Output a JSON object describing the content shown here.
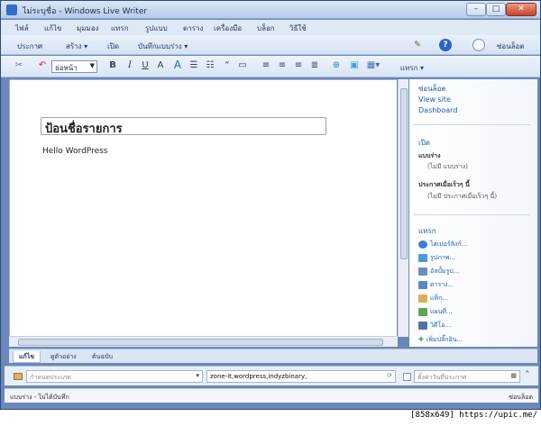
{
  "window": {
    "title": "ไม่ระบุชื่อ - Windows Live Writer"
  },
  "menubar": {
    "items": [
      "ไฟล์",
      "แก้ไข",
      "มุมมอง",
      "แทรก",
      "รูปแบบ",
      "ตาราง",
      "เครื่องมือ",
      "บล็อก",
      "วิธีใช้"
    ]
  },
  "commandbar": {
    "publish": "ประกาศ",
    "new": "สร้าง",
    "open": "เปิด",
    "save_draft": "บันทึกแบบร่าง",
    "blog_name": "ซ่อนล็อต"
  },
  "formatbar": {
    "style_value": "ย่อหน้า",
    "bold": "B",
    "italic": "I",
    "underline": "U",
    "insert_label": "แทรก"
  },
  "editor": {
    "post_title": "ป้อนชื่อรายการ",
    "body": "Hello WordPress"
  },
  "sidebar": {
    "blog_heading": "ซ่อนล็อต",
    "blog_links": [
      "View site",
      "Dashboard"
    ],
    "open_heading": "เปิด",
    "drafts_label": "แบบร่าง",
    "drafts_empty": "(ไม่มี แบบร่าง)",
    "recent_label": "ประกาศเมื่อเร็วๆ นี้",
    "recent_empty": "(ไม่มี ประกาศเมื่อเร็วๆ นี้)",
    "insert_heading": "แทรก",
    "insert_items": [
      {
        "label": "ไฮเปอร์ลิงก์...",
        "icon": "hyperlink-icon",
        "color": "#3b7ed0"
      },
      {
        "label": "รูปภาพ...",
        "icon": "picture-icon",
        "color": "#4a9ad8"
      },
      {
        "label": "อัลบั้มรูป...",
        "icon": "photo-album-icon",
        "color": "#6a8fbf"
      },
      {
        "label": "ตาราง...",
        "icon": "table-icon",
        "color": "#5b88c5"
      },
      {
        "label": "แท็ก...",
        "icon": "tag-icon",
        "color": "#d8b15a"
      },
      {
        "label": "แผนที่...",
        "icon": "map-icon",
        "color": "#5aa55a"
      },
      {
        "label": "วิดีโอ...",
        "icon": "video-icon",
        "color": "#4f72a8"
      },
      {
        "label": "เพิ่มปลั๊กอิน...",
        "icon": "add-plugin-icon",
        "color": "#3aa33a"
      }
    ]
  },
  "tabs": [
    "แก้ไข",
    "ดูตัวอย่าง",
    "ต้นฉบับ"
  ],
  "properties": {
    "category_placeholder": "กำหนดประเภท",
    "tags_value": "zone-it,wordpress,indyzbinary,",
    "date_placeholder": "ตั้งค่าวันที่ประกาศ"
  },
  "statusbar": {
    "left": "แบบร่าง - ไม่ได้บันทึก",
    "right": "ซ่อนล็อต"
  },
  "watermark": "[858x649] https://upic.me/"
}
